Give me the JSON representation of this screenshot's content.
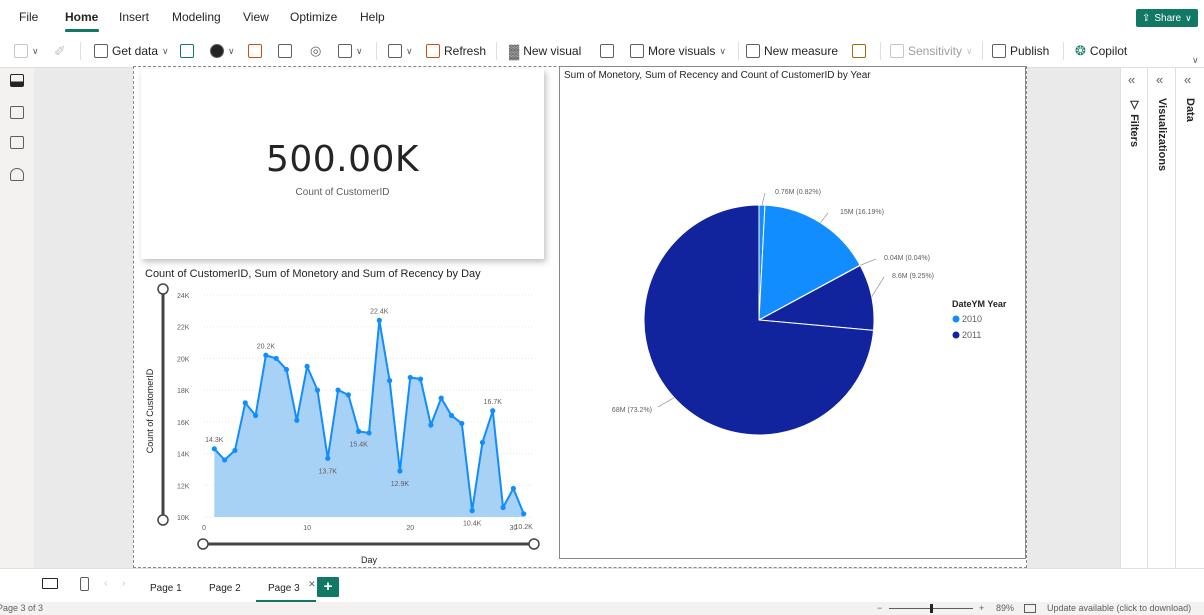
{
  "menu": {
    "items": [
      "File",
      "Home",
      "Insert",
      "Modeling",
      "View",
      "Optimize",
      "Help"
    ],
    "active": "Home",
    "share_label": "Share"
  },
  "ribbon": {
    "get_data": "Get data",
    "refresh": "Refresh",
    "new_visual": "New visual",
    "more_visuals": "More visuals",
    "new_measure": "New measure",
    "sensitivity": "Sensitivity",
    "publish": "Publish",
    "copilot": "Copilot"
  },
  "card": {
    "value": "500.00K",
    "label": "Count of CustomerID"
  },
  "area_chart": {
    "title": "Count of CustomerID, Sum of Monetory and Sum of Recency by Day",
    "xlabel": "Day",
    "ylabel": "Count of CustomerID",
    "accent_color": "#118DFF",
    "fill_color": "#A7D1F5"
  },
  "pie_chart": {
    "title": "Sum of Monetory, Sum of Recency and Count of CustomerID by Year",
    "legend_title": "DateYM Year",
    "labels": [
      "0.76M (0.82%)",
      "15M (16.19%)",
      "0.04M (0.04%)",
      "8.6M (9.25%)",
      "68M (73.2%)"
    ]
  },
  "panes": {
    "filters": "Filters",
    "visualizations": "Visualizations",
    "data": "Data"
  },
  "tabs": {
    "pages": [
      "Page 1",
      "Page 2",
      "Page 3"
    ],
    "active": "Page 3",
    "add": "+"
  },
  "status": {
    "page_info": "Page 3 of 3",
    "zoom": "89%",
    "update": "Update available (click to download)"
  },
  "chart_data": [
    {
      "type": "area",
      "title": "Count of CustomerID, Sum of Monetory and Sum of Recency by Day",
      "xlabel": "Day",
      "ylabel": "Count of CustomerID",
      "x": [
        1,
        2,
        3,
        4,
        5,
        6,
        7,
        8,
        9,
        10,
        11,
        12,
        13,
        14,
        15,
        16,
        17,
        18,
        19,
        20,
        21,
        22,
        23,
        24,
        25,
        26,
        27,
        28,
        29,
        30,
        31
      ],
      "values": [
        14.3,
        13.6,
        14.2,
        17.2,
        16.4,
        20.2,
        20.0,
        19.3,
        16.1,
        19.5,
        18.0,
        13.7,
        18.0,
        17.7,
        15.4,
        15.3,
        22.4,
        18.6,
        12.9,
        18.8,
        18.7,
        15.8,
        17.5,
        16.4,
        15.9,
        10.4,
        14.7,
        16.7,
        10.6,
        11.8,
        10.2
      ],
      "data_labels": {
        "6": "20.2K",
        "1": "14.3K",
        "12": "13.7K",
        "15": "15.4K",
        "17": "22.4K",
        "19": "12.9K",
        "26": "10.4K",
        "28": "16.7K",
        "31": "10.2K"
      },
      "ylim": [
        10,
        24
      ],
      "xlim": [
        0,
        32
      ],
      "yticks": [
        "10K",
        "12K",
        "14K",
        "16K",
        "18K",
        "20K",
        "22K",
        "24K"
      ],
      "xticks": [
        "0",
        "10",
        "20",
        "30"
      ],
      "grid": true
    },
    {
      "type": "pie",
      "title": "Sum of Monetory, Sum of Recency and Count of CustomerID by Year",
      "legend_title": "DateYM Year",
      "series": [
        {
          "name": "2010",
          "color": "#118DFF"
        },
        {
          "name": "2011",
          "color": "#12239E"
        }
      ],
      "slices": [
        {
          "label": "0.76M (0.82%)",
          "value": 0.82,
          "color": "#118DFF"
        },
        {
          "label": "15M (16.19%)",
          "value": 16.19,
          "color": "#118DFF"
        },
        {
          "label": "0.04M (0.04%)",
          "value": 0.04,
          "color": "#118DFF"
        },
        {
          "label": "8.6M (9.25%)",
          "value": 9.25,
          "color": "#12239E"
        },
        {
          "label": "68M (73.2%)",
          "value": 73.2,
          "color": "#12239E"
        }
      ],
      "legend": "right"
    }
  ]
}
